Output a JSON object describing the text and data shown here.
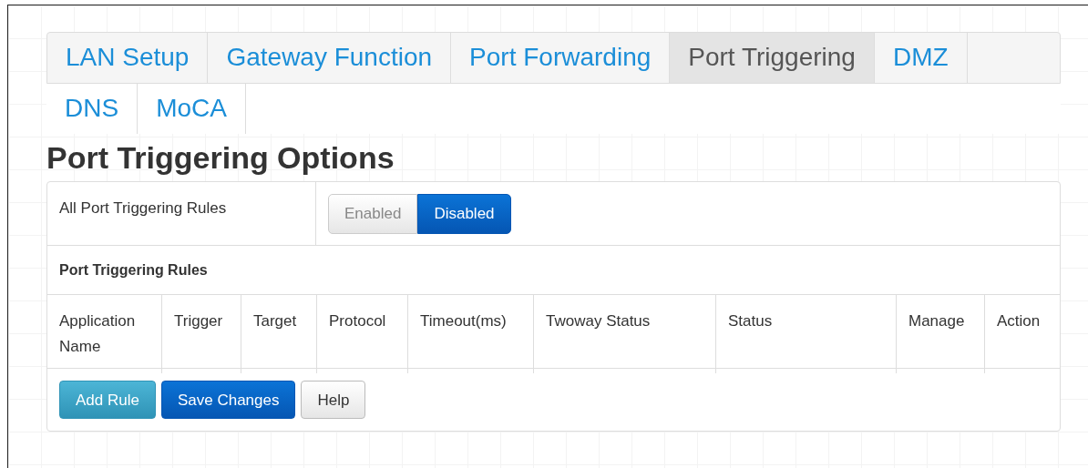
{
  "tab_rows": [
    [
      {
        "label": "LAN Setup",
        "selected": false
      },
      {
        "label": "Gateway Function",
        "selected": false
      },
      {
        "label": "Port Forwarding",
        "selected": false
      },
      {
        "label": "Port Triggering",
        "selected": true
      },
      {
        "label": "DMZ",
        "selected": false
      }
    ],
    [
      {
        "label": "DNS",
        "selected": false
      },
      {
        "label": "MoCA",
        "selected": false
      }
    ]
  ],
  "heading": "Port Triggering Options",
  "master_switch": {
    "label": "All Port Triggering Rules",
    "options": [
      {
        "label": "Enabled",
        "selected": false
      },
      {
        "label": "Disabled",
        "selected": true
      }
    ]
  },
  "rules_title": "Port Triggering Rules",
  "table": {
    "columns": [
      "Application Name",
      "Trigger",
      "Target",
      "Protocol",
      "Timeout(ms)",
      "Twoway Status",
      "Status",
      "Manage",
      "Action"
    ]
  },
  "buttons": [
    {
      "label": "Add Rule",
      "kind": "info"
    },
    {
      "label": "Save Changes",
      "kind": "primary"
    },
    {
      "label": "Help",
      "kind": "default"
    }
  ]
}
